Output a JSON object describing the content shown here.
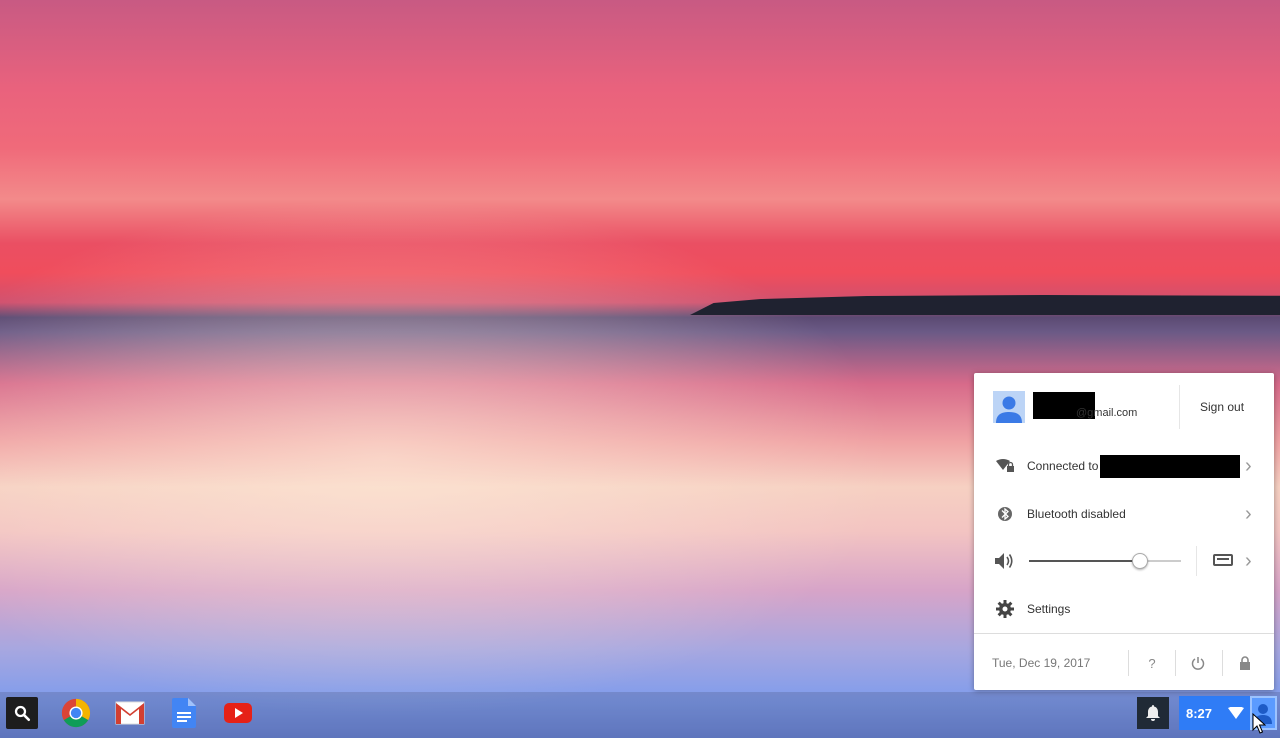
{
  "desktop": {
    "shelf_apps": [
      {
        "name": "Chrome",
        "icon": "chrome-icon"
      },
      {
        "name": "Gmail",
        "icon": "gmail-icon"
      },
      {
        "name": "Docs",
        "icon": "docs-icon"
      },
      {
        "name": "YouTube",
        "icon": "youtube-icon"
      }
    ]
  },
  "status_area": {
    "time": "8:27"
  },
  "tray": {
    "user": {
      "email_suffix": "@gmail.com",
      "sign_out_label": "Sign out"
    },
    "network": {
      "label": "Connected to"
    },
    "bluetooth": {
      "label": "Bluetooth disabled"
    },
    "volume": {
      "level": 0.73
    },
    "settings": {
      "label": "Settings"
    },
    "footer": {
      "date": "Tue, Dec 19, 2017",
      "help_label": "?"
    }
  },
  "colors": {
    "status_blue": "#2f7cf6",
    "launcher_bg": "#1d1d1d"
  }
}
